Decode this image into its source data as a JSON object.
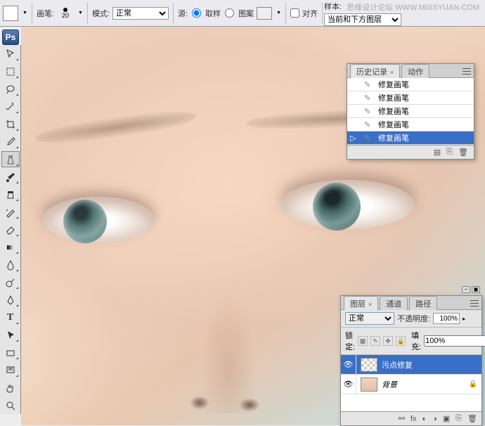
{
  "watermark": "思缘设计论坛 WWW.MISSYUAN.COM",
  "options_bar": {
    "brush_label": "画笔:",
    "brush_size": "20",
    "mode_label": "模式:",
    "mode_value": "正常",
    "source_label": "源:",
    "source_sampled": "取样",
    "source_pattern": "图案",
    "aligned_label": "对齐",
    "sample_label": "样本:",
    "sample_value": "当前和下方图层"
  },
  "app_badge": "Ps",
  "history_panel": {
    "tabs": {
      "history": "历史记录",
      "actions": "动作"
    },
    "items": [
      {
        "label": "修复画笔",
        "selected": false
      },
      {
        "label": "修复画笔",
        "selected": false
      },
      {
        "label": "修复画笔",
        "selected": false
      },
      {
        "label": "修复画笔",
        "selected": false
      },
      {
        "label": "修复画笔",
        "selected": true
      }
    ]
  },
  "layers_panel": {
    "tabs": {
      "layers": "图层",
      "channels": "通道",
      "paths": "路径"
    },
    "blend_mode": "正常",
    "opacity_label": "不透明度:",
    "opacity_value": "100%",
    "lock_label": "锁定:",
    "fill_label": "填充:",
    "fill_value": "100%",
    "layers": [
      {
        "name": "污点修复",
        "selected": true,
        "thumb": "checker",
        "locked": false
      },
      {
        "name": "背景",
        "selected": false,
        "thumb": "photo",
        "locked": true
      }
    ]
  }
}
